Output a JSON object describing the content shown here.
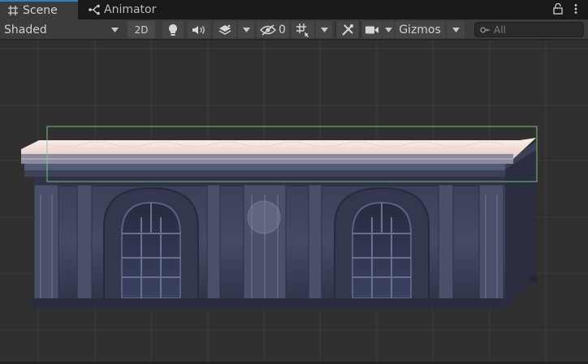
{
  "tabs": [
    {
      "label": "Scene",
      "icon": "grid-hash-icon",
      "active": true
    },
    {
      "label": "Animator",
      "icon": "animator-branch-icon",
      "active": false
    }
  ],
  "window_controls": {
    "lock_icon": "lock-icon",
    "menu_icon": "kebab-menu-icon"
  },
  "toolbar": {
    "shading_mode": "Shaded",
    "mode_2d_label": "2D",
    "hidden_count": "0",
    "gizmos_label": "Gizmos",
    "search_placeholder": "All"
  },
  "colors": {
    "tab_accent": "#3a79bb",
    "toolbar_bg": "#3c3c3c",
    "viewport_bg": "#303030",
    "selection_outline": "#7fd07f"
  }
}
